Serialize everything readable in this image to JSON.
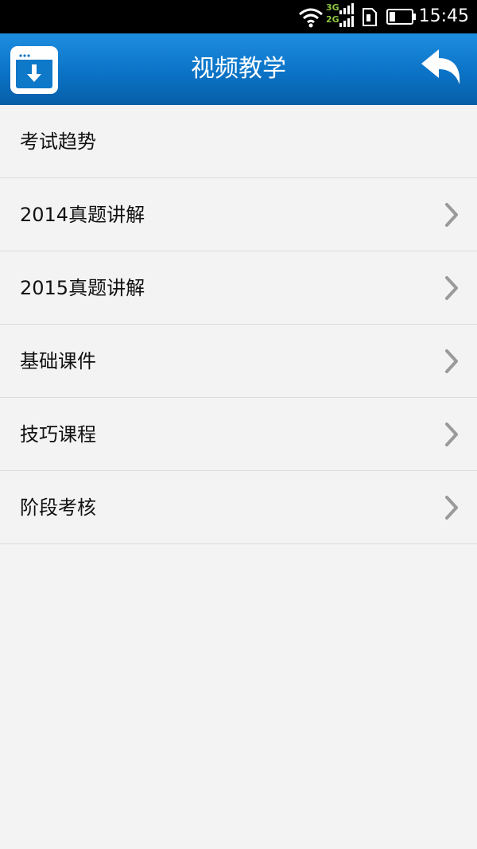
{
  "status_bar": {
    "time": "15:45",
    "network_3g": "3G",
    "network_2g": "2G",
    "icons": [
      "wifi-icon",
      "signal-icon",
      "sim-icon",
      "battery-icon"
    ]
  },
  "header": {
    "title": "视频教学",
    "logo_icon": "download-window-icon",
    "back_icon": "back-arrow-icon",
    "colors": {
      "bar_top": "#1e8ee0",
      "bar_bottom": "#075ea8",
      "text": "#ffffff"
    }
  },
  "list": {
    "items": [
      {
        "label": "考试趋势",
        "has_chevron": false
      },
      {
        "label": "2014真题讲解",
        "has_chevron": true
      },
      {
        "label": "2015真题讲解",
        "has_chevron": true
      },
      {
        "label": "基础课件",
        "has_chevron": true
      },
      {
        "label": "技巧课程",
        "has_chevron": true
      },
      {
        "label": "阶段考核",
        "has_chevron": true
      }
    ]
  }
}
